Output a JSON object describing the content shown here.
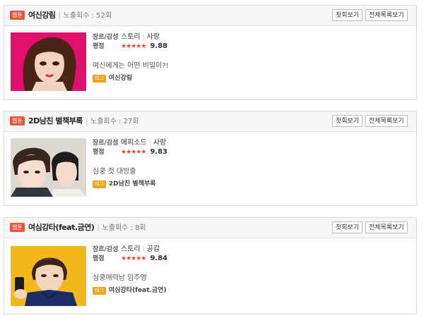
{
  "cards": [
    {
      "badge": "웹툰",
      "title": "여신강림",
      "views": "노출회수 : 52회",
      "btn_first": "첫회보기",
      "btn_list": "전체목록보기",
      "genre_label": "장르/감성",
      "genres": [
        "스토리",
        "사랑"
      ],
      "rating_label": "평점",
      "stars": "★★★★★",
      "score": "9.88",
      "desc": "여신에게는 어떤 비밀이?!",
      "tag_label": "태그",
      "tag": "여신강림",
      "thumb_bg": "#e0106e"
    },
    {
      "badge": "웹툰",
      "title": "2D남친 별책부록",
      "views": "노출회수 : 27회",
      "btn_first": "첫회보기",
      "btn_list": "전체목록보기",
      "genre_label": "장르/감성",
      "genres": [
        "에피소드",
        "사랑"
      ],
      "rating_label": "평점",
      "stars": "★★★★★",
      "score": "9.83",
      "desc": "심쿵 컷 대방출",
      "tag_label": "태그",
      "tag": "2D남친 별책부록",
      "thumb_bg": "#dcd8d2"
    },
    {
      "badge": "웹툰",
      "title": "여심강타(feat.금연)",
      "views": "노출회수 : 8회",
      "btn_first": "첫회보기",
      "btn_list": "전체목록보기",
      "genre_label": "장르/감성",
      "genres": [
        "스토리",
        "공감"
      ],
      "rating_label": "평점",
      "stars": "★★★★★",
      "score": "9.84",
      "desc": "심쿵매력남 임주영",
      "tag_label": "태그",
      "tag": "여심강타(feat.금연)",
      "thumb_bg": "#f2b91c"
    }
  ]
}
